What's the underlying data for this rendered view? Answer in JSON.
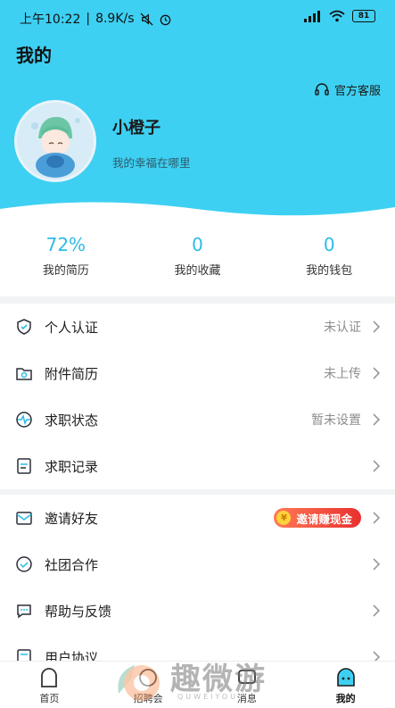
{
  "status_bar": {
    "time": "上午10:22",
    "net_speed": "8.9K/s",
    "battery": "81"
  },
  "header": {
    "title": "我的",
    "service_label": "官方客服"
  },
  "profile": {
    "name": "小橙子",
    "motto": "我的幸福在哪里"
  },
  "stats": [
    {
      "value": "72%",
      "label": "我的简历"
    },
    {
      "value": "0",
      "label": "我的收藏"
    },
    {
      "value": "0",
      "label": "我的钱包"
    }
  ],
  "menu_group_1": [
    {
      "label": "个人认证",
      "value": "未认证",
      "icon": "shield-check-icon"
    },
    {
      "label": "附件简历",
      "value": "未上传",
      "icon": "folder-icon"
    },
    {
      "label": "求职状态",
      "value": "暂未设置",
      "icon": "pulse-icon"
    },
    {
      "label": "求职记录",
      "value": "",
      "icon": "document-icon"
    }
  ],
  "menu_group_2": [
    {
      "label": "邀请好友",
      "badge": "邀请赚现金",
      "icon": "envelope-icon"
    },
    {
      "label": "社团合作",
      "icon": "handshake-icon"
    },
    {
      "label": "帮助与反馈",
      "icon": "chat-icon"
    },
    {
      "label": "用户协议",
      "icon": "agreement-icon"
    }
  ],
  "tabs": [
    {
      "label": "首页",
      "icon": "home-icon"
    },
    {
      "label": "招聘会",
      "icon": "fair-icon"
    },
    {
      "label": "消息",
      "icon": "message-icon"
    },
    {
      "label": "我的",
      "icon": "profile-icon",
      "active": true
    }
  ],
  "watermark": {
    "text": "趣微游",
    "sub": "QUWEIYOU"
  },
  "colors": {
    "header_bg": "#3ed0f2",
    "accent": "#2bbce6",
    "badge_start": "#ff7a55",
    "badge_end": "#e9302f"
  }
}
